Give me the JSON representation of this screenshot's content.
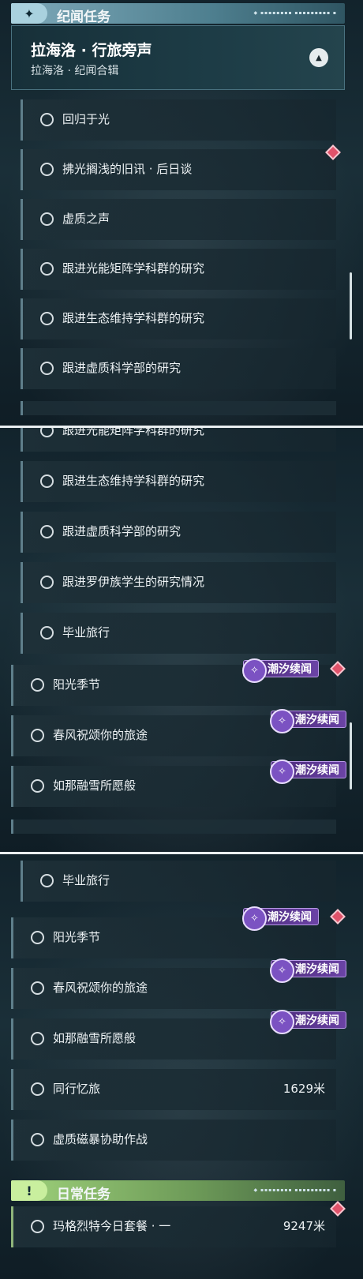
{
  "story_section": {
    "title": "纪闻任务",
    "deco_text": "◆ ▪▪▪▪▪▪▪▪  ▪▪▪▪▪▪▪▪▪ ▪",
    "chapter_title": "拉海洛 · 行旅旁声",
    "chapter_subtitle": "拉海洛 · 纪闻合辑"
  },
  "tag_label": "潮汐续闻",
  "quests": {
    "q1": "回归于光",
    "q2": "拂光搁浅的旧讯 · 后日谈",
    "q3": "虚质之声",
    "q4": "跟进光能矩阵学科群的研究",
    "q5": "跟进生态维持学科群的研究",
    "q6": "跟进虚质科学部的研究",
    "q7": "跟进罗伊族学生的研究情况",
    "q8": "毕业旅行",
    "q9": "阳光季节",
    "q10": "春风祝颂你的旅途",
    "q11": "如那融雪所愿般",
    "q12": "同行忆旅",
    "q13": "虚质磁暴协助作战"
  },
  "distances": {
    "q12": "1629米",
    "daily1": "9247米"
  },
  "daily_section": {
    "title": "日常任务",
    "deco_text": "◆ ▪▪▪▪▪▪▪▪  ▪▪▪▪▪▪▪▪▪ ▪",
    "daily1": "玛格烈特今日套餐 · 一"
  },
  "colors": {
    "story_accent": "#a9d1de",
    "daily_accent": "#c9ef9e",
    "tag_purple": "#6b43a6",
    "alert_red": "#e0526a"
  },
  "icons": [
    "sparkle-icon",
    "exclamation-icon",
    "chevron-up-icon",
    "radio-circle-icon",
    "tide-tag-icon",
    "alert-diamond-icon"
  ]
}
